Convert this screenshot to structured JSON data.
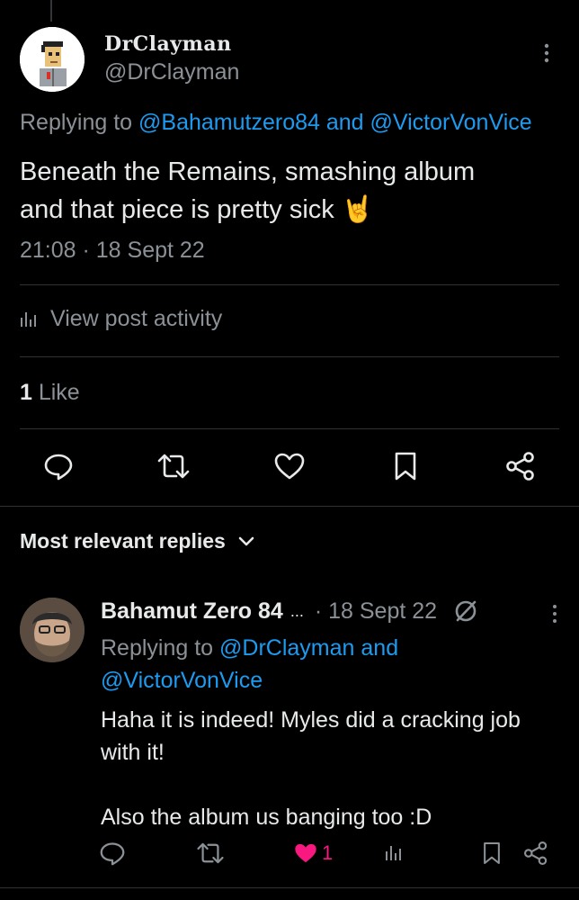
{
  "post": {
    "display_name": "DrClayman",
    "handle": "@DrClayman",
    "replying_prefix": "Replying to ",
    "replying_to_1": "@Bahamutzero84",
    "replying_joiner": " and ",
    "replying_to_2": "@VictorVonVice",
    "text_line1": "Beneath the Remains, smashing album",
    "text_line2": "and that piece is pretty sick ",
    "emoji": "🤘",
    "timestamp": "21:08 · 18 Sept 22",
    "activity_label": "View post activity",
    "like_count": "1",
    "like_label": " Like"
  },
  "replies_section": {
    "title": "Most relevant replies"
  },
  "reply": {
    "name": "Bahamut Zero 84",
    "ellipsis": "...",
    "date": "· 18 Sept 22",
    "replying_prefix": "Replying to ",
    "replying_to_1": "@DrClayman",
    "replying_joiner": " and",
    "replying_to_2": "@VictorVonVice",
    "text": "Haha it is indeed! Myles did a cracking job\nwith it!\n\nAlso the album us banging too :D",
    "like_count": "1"
  },
  "colors": {
    "background": "#000000",
    "text": "#e7e9ea",
    "muted": "#8b9196",
    "link": "#1d9bf0",
    "like": "#f91880"
  }
}
